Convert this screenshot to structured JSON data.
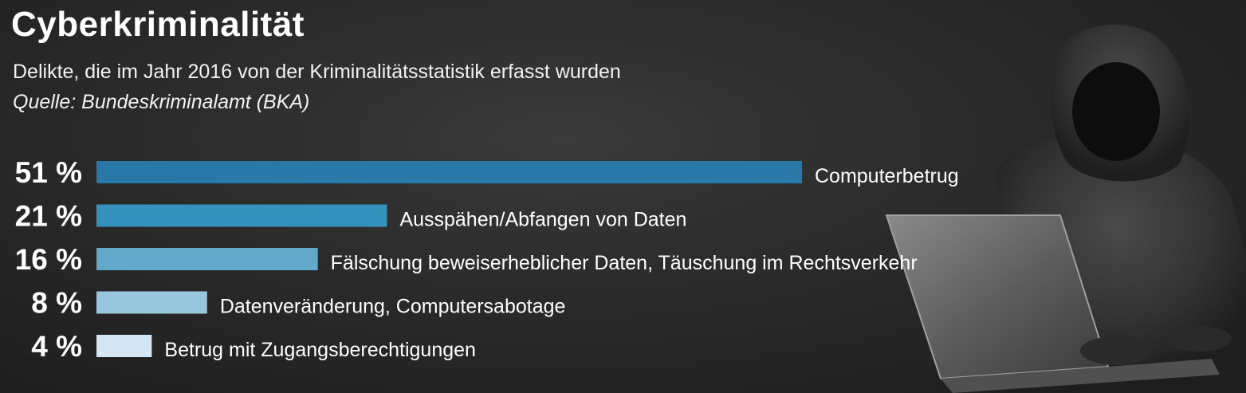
{
  "header": {
    "title": "Cyberkriminalität",
    "subtitle": "Delikte, die im Jahr 2016 von der Kriminalitätsstatistik erfasst wurden",
    "source": "Quelle: Bundeskriminalamt (BKA)"
  },
  "colors": {
    "background": "#262626",
    "bar_colors": [
      "#2a78a8",
      "#3492bd",
      "#62a9cb",
      "#98c6de",
      "#d4e6f3"
    ]
  },
  "chart_data": {
    "type": "bar",
    "orientation": "horizontal",
    "categories": [
      "Computerbetrug",
      "Ausspähen/Abfangen von Daten",
      "Fälschung beweiserheblicher Daten, Täuschung im Rechtsverkehr",
      "Datenveränderung, Computersabotage",
      "Betrug mit Zugangsberechtigungen"
    ],
    "values": [
      51,
      21,
      16,
      8,
      4
    ],
    "value_labels": [
      "51 %",
      "21 %",
      "16 %",
      "8 %",
      "4 %"
    ],
    "unit": "%",
    "xlim": [
      0,
      51
    ],
    "grid": false,
    "legend": "none"
  },
  "image": {
    "icon": "hooded-hacker-with-laptop"
  }
}
